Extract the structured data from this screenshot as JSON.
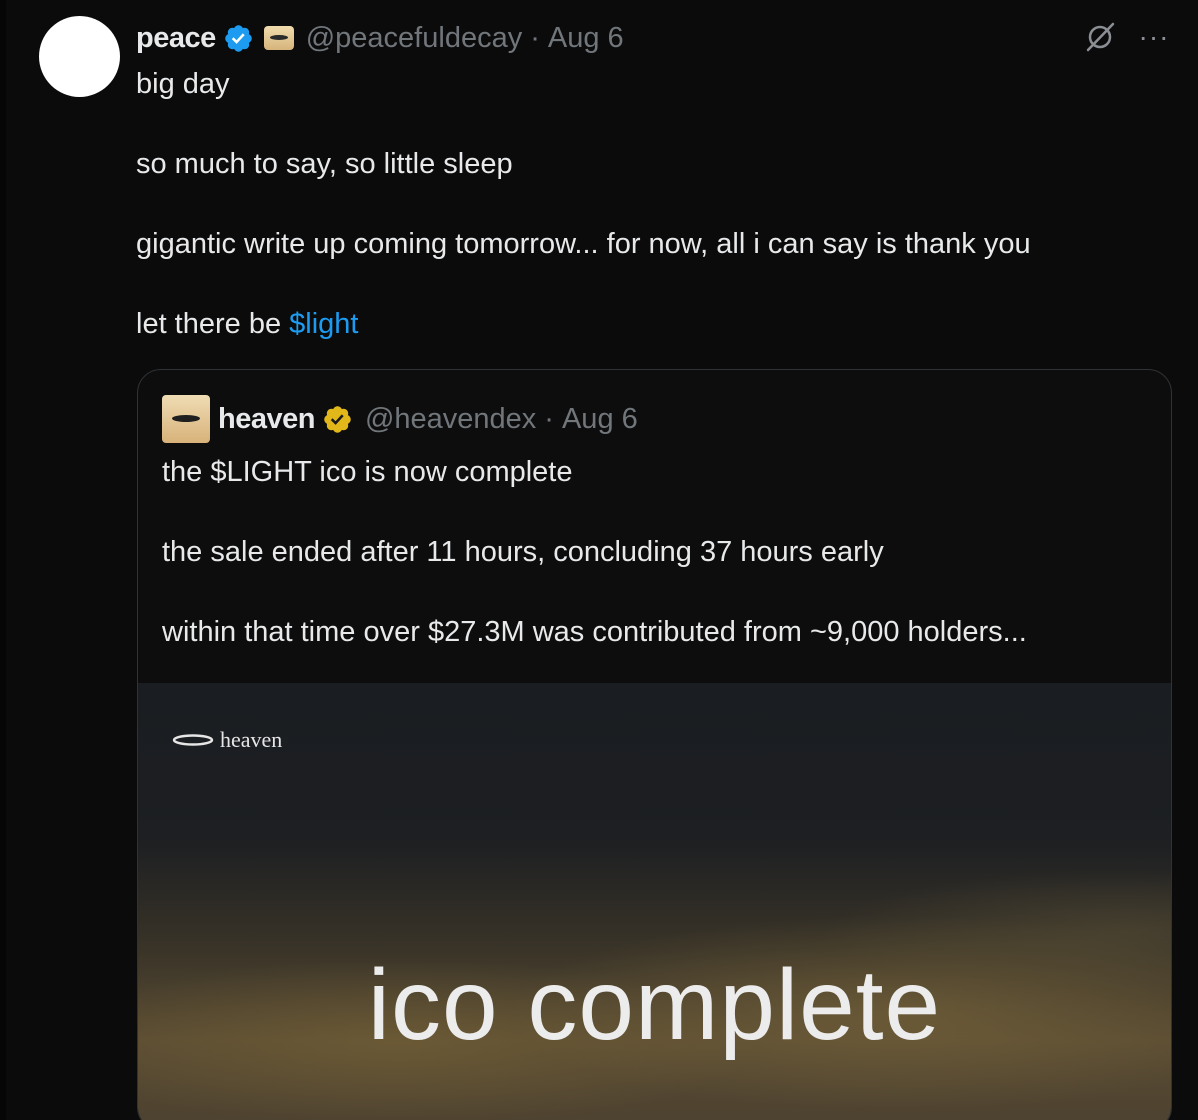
{
  "tweet": {
    "author_name": "peace",
    "handle": "@peacefuldecay",
    "separator": "·",
    "date": "Aug 6",
    "paragraphs": [
      "big day",
      "so much to say, so little sleep",
      "gigantic write up coming tomorrow... for now, all i can say is thank you"
    ],
    "last_line_prefix": "let there be ",
    "cashtag": "$light",
    "more_label": "···"
  },
  "quote": {
    "author_name": "heaven",
    "handle": "@heavendex",
    "separator": "·",
    "date": "Aug 6",
    "paragraphs": [
      "the $LIGHT ico is now complete",
      "the sale ended after 11 hours, concluding 37 hours early",
      "within that time over $27.3M was contributed from ~9,000 holders..."
    ],
    "media": {
      "logo_text": "heaven",
      "title": "ico complete"
    }
  },
  "colors": {
    "background": "#0b0b0c",
    "text": "#e7e9ea",
    "muted": "#71767b",
    "link": "#1d9bf0",
    "verified_blue": "#1d9bf0",
    "verified_gold": "#e2b719"
  },
  "icons": [
    "verified-badge-icon",
    "affiliate-badge-icon",
    "grok-icon",
    "more-icon",
    "gold-verified-badge-icon",
    "halo-logo-icon"
  ]
}
